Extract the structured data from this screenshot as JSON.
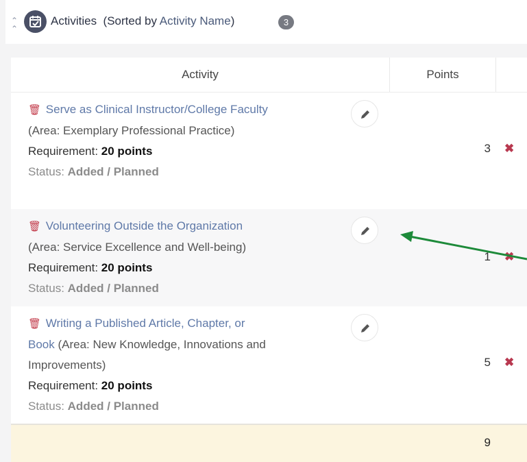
{
  "header": {
    "title": "Activities",
    "sorted_prefix": "(Sorted by",
    "sort_key": "Activity Name",
    "sorted_suffix": ")",
    "count": "3"
  },
  "table": {
    "columns": [
      "Activity",
      "Points"
    ],
    "requirement_label": "Requirement:",
    "status_label": "Status:",
    "rows": [
      {
        "name": "Serve as Clinical Instructor/College Faculty",
        "area": "(Area: Exemplary Professional Practice)",
        "requirement": "20 points",
        "status": "Added / Planned",
        "points": "3"
      },
      {
        "name": "Volunteering Outside the Organization",
        "area": "(Area: Service Excellence and Well-being)",
        "requirement": "20 points",
        "status": "Added / Planned",
        "points": "1"
      },
      {
        "name": "Writing a Published Article, Chapter, or Book",
        "area": "(Area: New Knowledge, Innovations and Improvements)",
        "requirement": "20 points",
        "status": "Added / Planned",
        "points": "5"
      }
    ],
    "total": "9"
  },
  "icons": {
    "collapse": "double-chevron-up-icon",
    "calendar": "calendar-check-icon",
    "trash": "trash-icon",
    "edit": "pencil-icon",
    "remove": "close-icon"
  },
  "colors": {
    "link": "#5f79a8",
    "danger": "#c23b4a",
    "total_row": "#fcf5df",
    "annotation_arrow": "#1d8a3a"
  }
}
